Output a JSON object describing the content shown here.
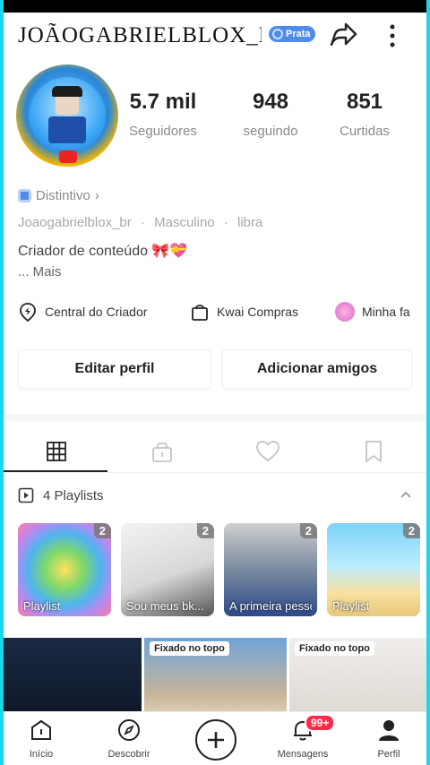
{
  "profile": {
    "username": "JOÃOGABRIELBLOX_B",
    "badge": "Prata",
    "stats": [
      {
        "value": "5.7 mil",
        "label": "Seguidores"
      },
      {
        "value": "948",
        "label": "seguindo"
      },
      {
        "value": "851",
        "label": "Curtidas"
      }
    ],
    "distintivo": "Distintivo",
    "meta": {
      "handle": "Joaogabrielblox_br",
      "gender": "Masculino",
      "sign": "libra"
    },
    "bio": "Criador de conteúdo 🎀💝",
    "more": "... Mais"
  },
  "quick_links": [
    {
      "label": "Central do Criador",
      "icon": "lightning-pin-icon"
    },
    {
      "label": "Kwai Compras",
      "icon": "shopping-bag-icon"
    },
    {
      "label": "Minha fa",
      "icon": "avatar-icon"
    }
  ],
  "buttons": {
    "edit": "Editar perfil",
    "add_friends": "Adicionar amigos"
  },
  "tabs": [
    {
      "name": "grid",
      "icon": "grid-icon",
      "active": true
    },
    {
      "name": "private",
      "icon": "lock-icon",
      "active": false
    },
    {
      "name": "liked",
      "icon": "heart-icon",
      "active": false
    },
    {
      "name": "saved",
      "icon": "bookmark-icon",
      "active": false
    }
  ],
  "playlists": {
    "header": "4 Playlists",
    "items": [
      {
        "title": "Playlist",
        "count": "2"
      },
      {
        "title": "Sou meus bk...",
        "count": "2"
      },
      {
        "title": "A primeira pessoa #robl...",
        "count": "2"
      },
      {
        "title": "Playlist",
        "count": "2"
      }
    ]
  },
  "videos": [
    {
      "pinned": ""
    },
    {
      "pinned": "Fixado no topo"
    },
    {
      "pinned": "Fixado no topo"
    }
  ],
  "nav": {
    "home": "Início",
    "discover": "Descobrir",
    "messages": "Mensagens",
    "profile": "Perfil",
    "notif_badge": "99+"
  },
  "colors": {
    "accent": "#4f8be8",
    "badge_red": "#ff2a4a",
    "edge_cyan": "#16d8e8"
  }
}
